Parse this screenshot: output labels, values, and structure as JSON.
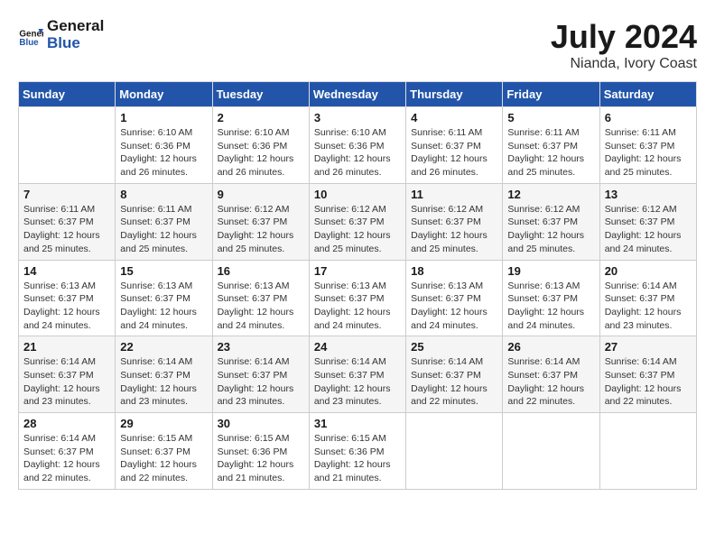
{
  "header": {
    "logo_text_general": "General",
    "logo_text_blue": "Blue",
    "month_year": "July 2024",
    "location": "Nianda, Ivory Coast"
  },
  "weekdays": [
    "Sunday",
    "Monday",
    "Tuesday",
    "Wednesday",
    "Thursday",
    "Friday",
    "Saturday"
  ],
  "weeks": [
    [
      {
        "day": "",
        "info": ""
      },
      {
        "day": "1",
        "info": "Sunrise: 6:10 AM\nSunset: 6:36 PM\nDaylight: 12 hours\nand 26 minutes."
      },
      {
        "day": "2",
        "info": "Sunrise: 6:10 AM\nSunset: 6:36 PM\nDaylight: 12 hours\nand 26 minutes."
      },
      {
        "day": "3",
        "info": "Sunrise: 6:10 AM\nSunset: 6:36 PM\nDaylight: 12 hours\nand 26 minutes."
      },
      {
        "day": "4",
        "info": "Sunrise: 6:11 AM\nSunset: 6:37 PM\nDaylight: 12 hours\nand 26 minutes."
      },
      {
        "day": "5",
        "info": "Sunrise: 6:11 AM\nSunset: 6:37 PM\nDaylight: 12 hours\nand 25 minutes."
      },
      {
        "day": "6",
        "info": "Sunrise: 6:11 AM\nSunset: 6:37 PM\nDaylight: 12 hours\nand 25 minutes."
      }
    ],
    [
      {
        "day": "7",
        "info": ""
      },
      {
        "day": "8",
        "info": "Sunrise: 6:11 AM\nSunset: 6:37 PM\nDaylight: 12 hours\nand 25 minutes."
      },
      {
        "day": "9",
        "info": "Sunrise: 6:12 AM\nSunset: 6:37 PM\nDaylight: 12 hours\nand 25 minutes."
      },
      {
        "day": "10",
        "info": "Sunrise: 6:12 AM\nSunset: 6:37 PM\nDaylight: 12 hours\nand 25 minutes."
      },
      {
        "day": "11",
        "info": "Sunrise: 6:12 AM\nSunset: 6:37 PM\nDaylight: 12 hours\nand 25 minutes."
      },
      {
        "day": "12",
        "info": "Sunrise: 6:12 AM\nSunset: 6:37 PM\nDaylight: 12 hours\nand 25 minutes."
      },
      {
        "day": "13",
        "info": "Sunrise: 6:12 AM\nSunset: 6:37 PM\nDaylight: 12 hours\nand 24 minutes."
      }
    ],
    [
      {
        "day": "14",
        "info": ""
      },
      {
        "day": "15",
        "info": "Sunrise: 6:13 AM\nSunset: 6:37 PM\nDaylight: 12 hours\nand 24 minutes."
      },
      {
        "day": "16",
        "info": "Sunrise: 6:13 AM\nSunset: 6:37 PM\nDaylight: 12 hours\nand 24 minutes."
      },
      {
        "day": "17",
        "info": "Sunrise: 6:13 AM\nSunset: 6:37 PM\nDaylight: 12 hours\nand 24 minutes."
      },
      {
        "day": "18",
        "info": "Sunrise: 6:13 AM\nSunset: 6:37 PM\nDaylight: 12 hours\nand 24 minutes."
      },
      {
        "day": "19",
        "info": "Sunrise: 6:13 AM\nSunset: 6:37 PM\nDaylight: 12 hours\nand 24 minutes."
      },
      {
        "day": "20",
        "info": "Sunrise: 6:14 AM\nSunset: 6:37 PM\nDaylight: 12 hours\nand 23 minutes."
      }
    ],
    [
      {
        "day": "21",
        "info": ""
      },
      {
        "day": "22",
        "info": "Sunrise: 6:14 AM\nSunset: 6:37 PM\nDaylight: 12 hours\nand 23 minutes."
      },
      {
        "day": "23",
        "info": "Sunrise: 6:14 AM\nSunset: 6:37 PM\nDaylight: 12 hours\nand 23 minutes."
      },
      {
        "day": "24",
        "info": "Sunrise: 6:14 AM\nSunset: 6:37 PM\nDaylight: 12 hours\nand 23 minutes."
      },
      {
        "day": "25",
        "info": "Sunrise: 6:14 AM\nSunset: 6:37 PM\nDaylight: 12 hours\nand 22 minutes."
      },
      {
        "day": "26",
        "info": "Sunrise: 6:14 AM\nSunset: 6:37 PM\nDaylight: 12 hours\nand 22 minutes."
      },
      {
        "day": "27",
        "info": "Sunrise: 6:14 AM\nSunset: 6:37 PM\nDaylight: 12 hours\nand 22 minutes."
      }
    ],
    [
      {
        "day": "28",
        "info": "Sunrise: 6:14 AM\nSunset: 6:37 PM\nDaylight: 12 hours\nand 22 minutes."
      },
      {
        "day": "29",
        "info": "Sunrise: 6:15 AM\nSunset: 6:37 PM\nDaylight: 12 hours\nand 22 minutes."
      },
      {
        "day": "30",
        "info": "Sunrise: 6:15 AM\nSunset: 6:36 PM\nDaylight: 12 hours\nand 21 minutes."
      },
      {
        "day": "31",
        "info": "Sunrise: 6:15 AM\nSunset: 6:36 PM\nDaylight: 12 hours\nand 21 minutes."
      },
      {
        "day": "",
        "info": ""
      },
      {
        "day": "",
        "info": ""
      },
      {
        "day": "",
        "info": ""
      }
    ]
  ],
  "week1_sun_info": "",
  "week2_sun_info": "Sunrise: 6:11 AM\nSunset: 6:37 PM\nDaylight: 12 hours\nand 25 minutes.",
  "week3_sun_info": "Sunrise: 6:13 AM\nSunset: 6:37 PM\nDaylight: 12 hours\nand 24 minutes.",
  "week4_sun_info": "Sunrise: 6:14 AM\nSunset: 6:37 PM\nDaylight: 12 hours\nand 23 minutes."
}
